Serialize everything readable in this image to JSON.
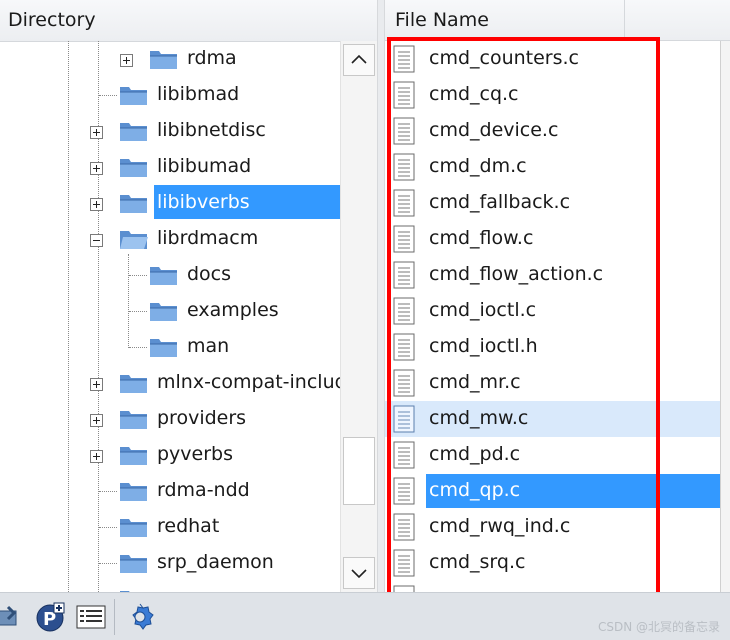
{
  "directory_pane": {
    "header": "Directory",
    "items": [
      {
        "label": "rdma",
        "expander": "plus"
      },
      {
        "label": "libibmad",
        "expander": "none"
      },
      {
        "label": "libibnetdisc",
        "expander": "plus"
      },
      {
        "label": "libibumad",
        "expander": "plus"
      },
      {
        "label": "libibverbs",
        "expander": "plus",
        "selected": true
      },
      {
        "label": "librdmacm",
        "expander": "minus"
      },
      {
        "label": "docs",
        "expander": "none"
      },
      {
        "label": "examples",
        "expander": "none"
      },
      {
        "label": "man",
        "expander": "none"
      },
      {
        "label": "mlnx-compat-includ",
        "expander": "plus"
      },
      {
        "label": "providers",
        "expander": "plus"
      },
      {
        "label": "pyverbs",
        "expander": "plus"
      },
      {
        "label": "rdma-ndd",
        "expander": "none"
      },
      {
        "label": "redhat",
        "expander": "none"
      },
      {
        "label": "srp_daemon",
        "expander": "none"
      }
    ]
  },
  "file_pane": {
    "header": "File Name",
    "files": [
      {
        "name": "cmd_counters.c"
      },
      {
        "name": "cmd_cq.c"
      },
      {
        "name": "cmd_device.c"
      },
      {
        "name": "cmd_dm.c"
      },
      {
        "name": "cmd_fallback.c"
      },
      {
        "name": "cmd_flow.c"
      },
      {
        "name": "cmd_flow_action.c"
      },
      {
        "name": "cmd_ioctl.c"
      },
      {
        "name": "cmd_ioctl.h"
      },
      {
        "name": "cmd_mr.c"
      },
      {
        "name": "cmd_mw.c",
        "state": "hover"
      },
      {
        "name": "cmd_pd.c"
      },
      {
        "name": "cmd_qp.c",
        "state": "selected"
      },
      {
        "name": "cmd_rwq_ind.c"
      },
      {
        "name": "cmd_srq.c"
      }
    ]
  },
  "toolbar": {
    "icons": [
      "project-settings-icon",
      "add-project-icon",
      "file-list-icon",
      "gear-icon"
    ]
  },
  "watermark": "CSDN @北冥的备忘录",
  "colors": {
    "selection": "#3399ff",
    "hover": "#d9e9fb",
    "highlight_box": "#ff0000",
    "folder_blue": "#5b8fd0"
  }
}
